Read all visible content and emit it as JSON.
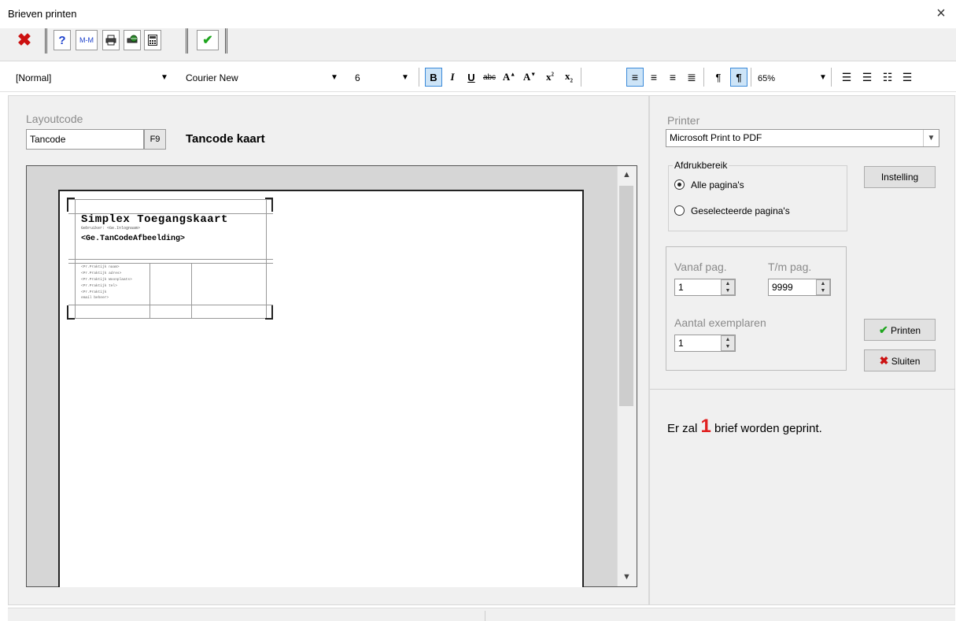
{
  "window": {
    "title": "Brieven printen",
    "close_glyph": "×"
  },
  "toolbar": {
    "buttons": [
      {
        "name": "cancel-x-icon",
        "glyph": "✖",
        "color": "#cc1111"
      },
      {
        "name": "help-icon",
        "glyph": "?",
        "color": "#1a3fcc"
      },
      {
        "name": "mm-icon",
        "glyph": "M-M",
        "color": "#1a3fcc"
      },
      {
        "name": "printer-icon",
        "glyph": "🖶",
        "color": "#333333"
      },
      {
        "name": "print-web-icon",
        "glyph": "⊕",
        "color": "#1a7a1a"
      },
      {
        "name": "calculator-icon",
        "glyph": "▦",
        "color": "#333333"
      },
      {
        "name": "confirm-check-icon",
        "glyph": "✔",
        "color": "#1ea51e"
      }
    ]
  },
  "format_bar": {
    "style": "[Normal]",
    "font": "Courier New",
    "size": "6",
    "zoom": "65%",
    "dropdown_glyph": "▼"
  },
  "layout": {
    "label": "Layoutcode",
    "code": "Tancode",
    "f9_label": "F9",
    "name": "Tancode kaart"
  },
  "preview": {
    "card_title": "Simplex Toegangskaart",
    "card_subtitle": "Gebruiker: <Ge.Inlognaam>",
    "card_field": "<Ge.TanCodeAfbeelding>",
    "address_lines": [
      "<Pr.Praktijk naam>",
      "<Pr.Praktijk adres>",
      "<Pr.Praktijk Woonplaats>",
      "<Pr.Praktijk tel>",
      "<Pr.Praktijk",
      "email beheer>"
    ]
  },
  "printer": {
    "label": "Printer",
    "selected": "Microsoft Print to PDF",
    "setting_button": "Instelling"
  },
  "range": {
    "group_label": "Afdrukbereik",
    "all_label": "Alle pagina's",
    "selected_label": "Geselecteerde pagina's",
    "from_label": "Vanaf pag.",
    "from_value": "1",
    "to_label": "T/m pag.",
    "to_value": "9999",
    "copies_label": "Aantal exemplaren",
    "copies_value": "1"
  },
  "actions": {
    "print_label": "Printen",
    "close_label": "Sluiten"
  },
  "status": {
    "prefix": "Er zal",
    "count": "1",
    "suffix": "brief worden geprint."
  },
  "colors": {
    "accent_blue": "#3b8ad9",
    "status_red": "#e02020",
    "check_green": "#1ea51e",
    "close_red": "#cc1111"
  }
}
